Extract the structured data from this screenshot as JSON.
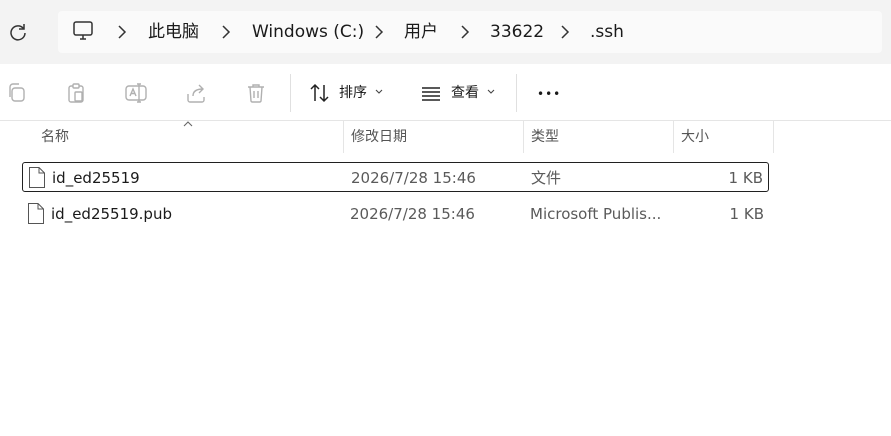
{
  "address_bar": {
    "breadcrumbs": [
      "此电脑",
      "Windows (C:)",
      "用户",
      "33622",
      ".ssh"
    ]
  },
  "toolbar": {
    "sort_label": "排序",
    "view_label": "查看",
    "more_label": "•••"
  },
  "columns": {
    "name": "名称",
    "modified": "修改日期",
    "type": "类型",
    "size": "大小"
  },
  "files": [
    {
      "name": "id_ed25519",
      "modified": "2026/7/28 15:46",
      "type": "文件",
      "size": "1 KB",
      "selected": true
    },
    {
      "name": "id_ed25519.pub",
      "modified": "2026/7/28 15:46",
      "type": "Microsoft Publis...",
      "size": "1 KB",
      "selected": false
    }
  ]
}
